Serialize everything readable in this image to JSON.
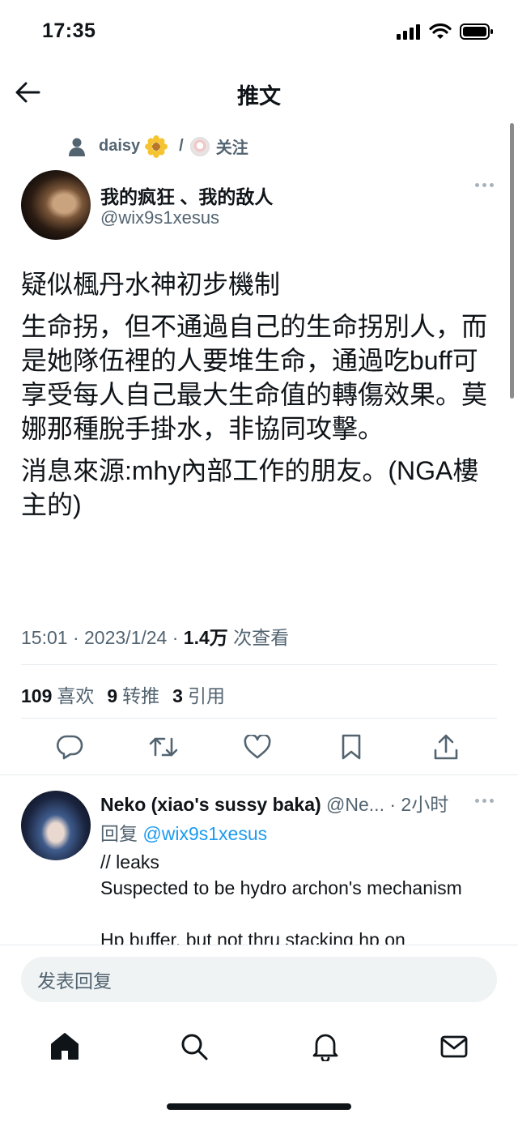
{
  "status_bar": {
    "time": "17:35"
  },
  "header": {
    "title": "推文"
  },
  "social_context": {
    "user": "daisy",
    "separator": "/",
    "follow_label": "关注"
  },
  "author": {
    "name": "我的疯狂 、我的敌人",
    "handle": "@wix9s1xesus"
  },
  "tweet": {
    "paragraphs": [
      "疑似楓丹水神初步機制",
      "生命拐，但不通過自己的生命拐別人，而是她隊伍裡的人要堆生命，通過吃buff可享受每人自己最大生命值的轉傷效果。莫娜那種脫手掛水，非協同攻擊。",
      "消息來源:mhy內部工作的朋友。(NGA樓主的)"
    ]
  },
  "meta": {
    "time": "15:01",
    "date": "2023/1/24",
    "sep": "·",
    "views_count": "1.4万",
    "views_label": "次查看"
  },
  "stats": {
    "likes_count": "109",
    "likes_label": "喜欢",
    "retweets_count": "9",
    "retweets_label": "转推",
    "quotes_count": "3",
    "quotes_label": "引用"
  },
  "reply": {
    "name": "Neko (xiao's sussy baka)",
    "handle_trunc": "@Ne...",
    "sep": "·",
    "time": "2小时",
    "reply_to_label": "回复",
    "reply_to_handle": "@wix9s1xesus",
    "text_lines": [
      "// leaks",
      "Suspected to be hydro archon's mechanism",
      "",
      "Hp buffer, but not thru stacking hp on"
    ]
  },
  "composer": {
    "placeholder": "发表回复"
  },
  "icons": {
    "back": "arrow-left-icon",
    "reply": "reply-icon",
    "retweet": "retweet-icon",
    "like": "heart-icon",
    "bookmark": "bookmark-icon",
    "share": "share-icon",
    "home": "home-icon",
    "search": "search-icon",
    "notifications": "bell-icon",
    "messages": "mail-icon"
  },
  "colors": {
    "accent": "#1d9bf0",
    "text": "#0f1419",
    "muted": "#536471",
    "divider": "#e6ebef"
  }
}
